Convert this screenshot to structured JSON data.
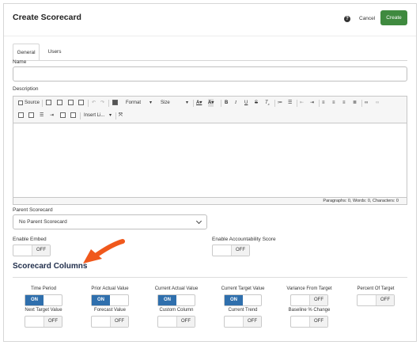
{
  "header": {
    "title": "Create Scorecard",
    "help_icon": "question-circle-icon",
    "cancel_label": "Cancel",
    "create_label": "Create",
    "create_color": "#3f8a3f"
  },
  "tabs": [
    {
      "label": "General",
      "active": true
    },
    {
      "label": "Users",
      "active": false
    }
  ],
  "form": {
    "name_label": "Name",
    "name_value": "",
    "description_label": "Description",
    "editor": {
      "row1": {
        "source": "Source",
        "format": "Format",
        "size": "Size",
        "icons": [
          "source-icon",
          "print-icon",
          "copy-icon",
          "paste-icon",
          "paste-text-icon",
          "undo-icon",
          "redo-icon",
          "template-icon",
          "font-color-icon",
          "background-color-icon",
          "bold-icon",
          "italic-icon",
          "underline-icon",
          "strike-icon",
          "remove-format-icon",
          "numbered-list-icon",
          "bulleted-list-icon",
          "outdent-icon",
          "indent-icon",
          "align-left-icon",
          "align-center-icon",
          "align-right-icon",
          "justify-icon",
          "link-icon",
          "unlink-icon"
        ]
      },
      "row2": {
        "insert_link": "Insert Li...",
        "icons": [
          "image-icon",
          "table-icon",
          "horizontal-rule-icon",
          "anchor-icon",
          "media-icon",
          "document-icon",
          "maximize-icon"
        ]
      },
      "status": "Paragraphs: 0, Words: 0, Characters: 0"
    },
    "parent_label": "Parent Scorecard",
    "parent_value": "No Parent Scorecard",
    "enable_embed_label": "Enable Embed",
    "enable_embed_state": "OFF",
    "enable_accountability_label": "Enable Accountability Score",
    "enable_accountability_state": "OFF"
  },
  "columns_section": {
    "title": "Scorecard Columns",
    "accent_color": "#2f6fad",
    "items": [
      {
        "label": "Time Period",
        "state": "ON"
      },
      {
        "label": "Prior Actual Value",
        "state": "ON"
      },
      {
        "label": "Current Actual Value",
        "state": "ON"
      },
      {
        "label": "Current Target Value",
        "state": "ON"
      },
      {
        "label": "Variance From Target",
        "state": "OFF"
      },
      {
        "label": "Percent Of Target",
        "state": "OFF"
      },
      {
        "label": "Next Target Value",
        "state": "OFF"
      },
      {
        "label": "Forecast Value",
        "state": "OFF"
      },
      {
        "label": "Custom Column",
        "state": "OFF"
      },
      {
        "label": "Current Trend",
        "state": "OFF"
      },
      {
        "label": "Baseline % Change",
        "state": "OFF"
      }
    ]
  }
}
